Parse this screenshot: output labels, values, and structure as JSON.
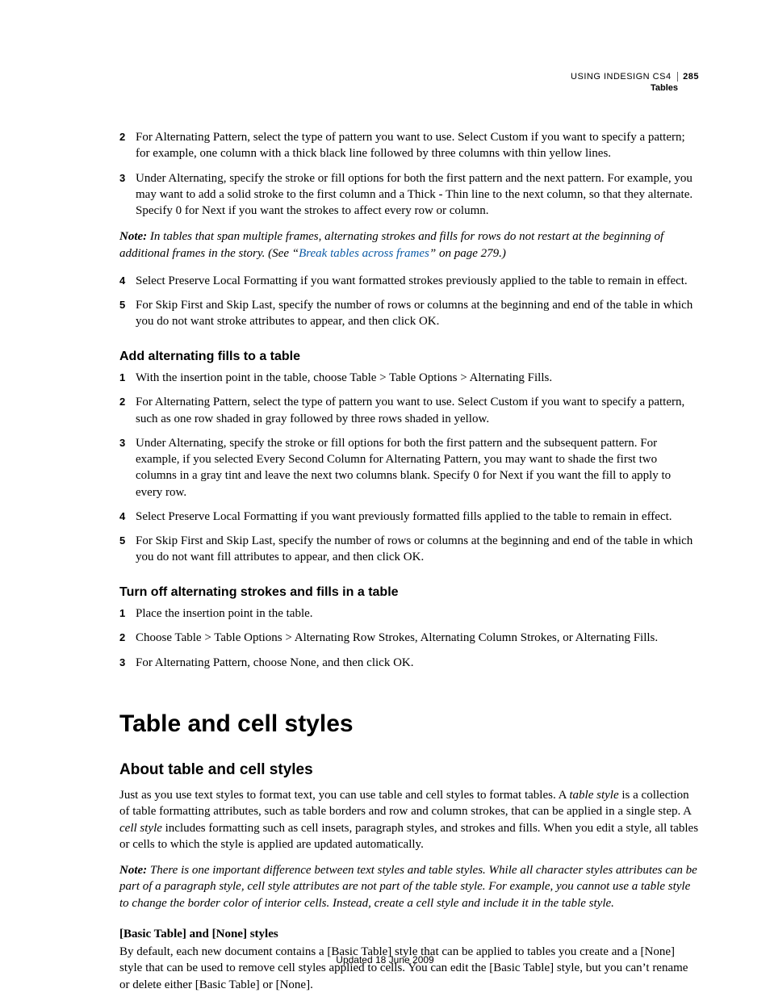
{
  "header": {
    "product": "USING INDESIGN CS4",
    "chapter": "Tables",
    "page": "285"
  },
  "blockA": {
    "steps": [
      {
        "n": "2",
        "text": "For Alternating Pattern, select the type of pattern you want to use. Select Custom if you want to specify a pattern; for example, one column with a thick black line followed by three columns with thin yellow lines."
      },
      {
        "n": "3",
        "text": "Under Alternating, specify the stroke or fill options for both the first pattern and the next pattern. For example, you may want to add a solid stroke to the first column and a Thick - Thin line to the next column, so that they alternate. Specify 0 for Next if you want the strokes to affect every row or column."
      }
    ],
    "note_label": "Note:",
    "note_pre": " In tables that span multiple frames, alternating strokes and fills for rows do not restart at the beginning of additional frames in the story. (See “",
    "note_link": "Break tables across frames",
    "note_post": "” on page 279.)",
    "steps2": [
      {
        "n": "4",
        "text": "Select Preserve Local Formatting if you want formatted strokes previously applied to the table to remain in effect."
      },
      {
        "n": "5",
        "text": "For Skip First and Skip Last, specify the number of rows or columns at the beginning and end of the table in which you do not want stroke attributes to appear, and then click OK."
      }
    ]
  },
  "blockB": {
    "heading": "Add alternating fills to a table",
    "steps": [
      {
        "n": "1",
        "text": "With the insertion point in the table, choose Table > Table Options > Alternating Fills."
      },
      {
        "n": "2",
        "text": "For Alternating Pattern, select the type of pattern you want to use. Select Custom if you want to specify a pattern, such as one row shaded in gray followed by three rows shaded in yellow."
      },
      {
        "n": "3",
        "text": "Under Alternating, specify the stroke or fill options for both the first pattern and the subsequent pattern. For example, if you selected Every Second Column for Alternating Pattern, you may want to shade the first two columns in a gray tint and leave the next two columns blank. Specify 0 for Next if you want the fill to apply to every row."
      },
      {
        "n": "4",
        "text": "Select Preserve Local Formatting if you want previously formatted fills applied to the table to remain in effect."
      },
      {
        "n": "5",
        "text": "For Skip First and Skip Last, specify the number of rows or columns at the beginning and end of the table in which you do not want fill attributes to appear, and then click OK."
      }
    ]
  },
  "blockC": {
    "heading": "Turn off alternating strokes and fills in a table",
    "steps": [
      {
        "n": "1",
        "text": "Place the insertion point in the table."
      },
      {
        "n": "2",
        "text": "Choose Table > Table Options > Alternating Row Strokes, Alternating Column Strokes, or Alternating Fills."
      },
      {
        "n": "3",
        "text": "For Alternating Pattern, choose None, and then click OK."
      }
    ]
  },
  "section": {
    "title": "Table and cell styles",
    "topic": "About table and cell styles",
    "para1a": "Just as you use text styles to format text, you can use table and cell styles to format tables. A ",
    "para1b": "table style",
    "para1c": " is a collection of table formatting attributes, such as table borders and row and column strokes, that can be applied in a single step. A ",
    "para1d": "cell style",
    "para1e": " includes formatting such as cell insets, paragraph styles, and strokes and fills. When you edit a style, all tables or cells to which the style is applied are updated automatically.",
    "note_label": "Note:",
    "note_body": " There is one important difference between text styles and table styles. While all character styles attributes can be part of a paragraph style, cell style attributes are not part of the table style. For example, you cannot use a table style to change the border color of interior cells. Instead, create a cell style and include it in the table style.",
    "runin": "[Basic Table] and [None] styles",
    "para2": "By default, each new document contains a [Basic Table] style that can be applied to tables you create and a [None] style that can be used to remove cell styles applied to cells. You can edit the [Basic Table] style, but you can’t rename or delete either [Basic Table] or [None]."
  },
  "footer": "Updated 18 June 2009"
}
